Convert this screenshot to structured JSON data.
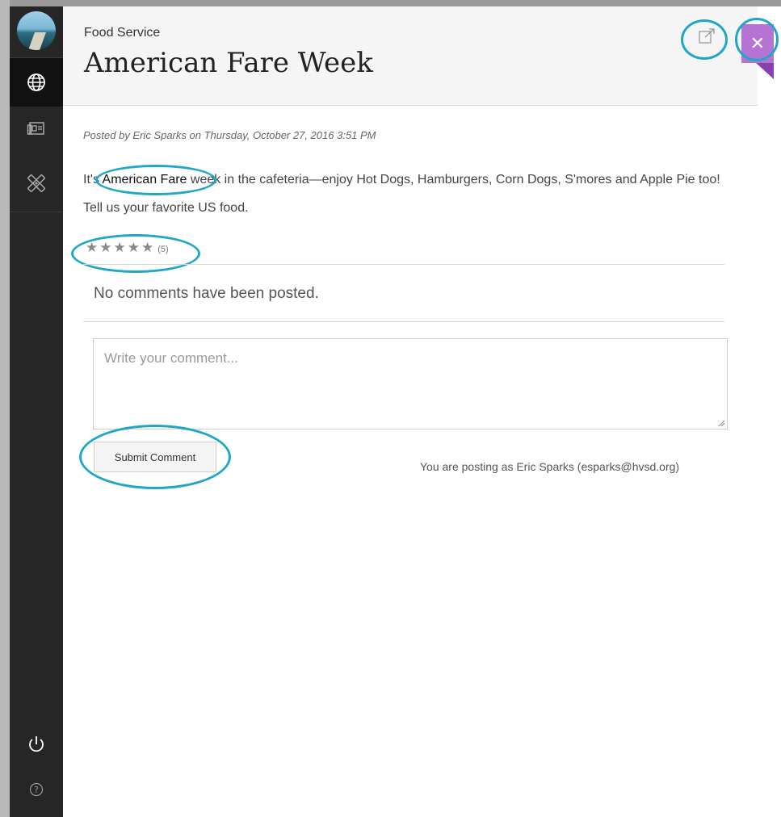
{
  "sidebar": {
    "items": [
      {
        "name": "globe",
        "icon": "globe-icon"
      },
      {
        "name": "news",
        "icon": "newspaper-icon"
      },
      {
        "name": "tools",
        "icon": "tools-icon"
      }
    ],
    "bottom": [
      {
        "name": "power",
        "icon": "power-icon"
      },
      {
        "name": "help",
        "icon": "help-icon"
      }
    ]
  },
  "header": {
    "category": "Food Service",
    "title": "American Fare Week"
  },
  "post": {
    "byline": "Posted by Eric Sparks on Thursday, October 27, 2016 3:51 PM",
    "body_prefix": "It's ",
    "body_highlight": "American Fare",
    "body_suffix": " week in the cafeteria—enjoy Hot Dogs, Hamburgers, Corn Dogs, S'mores and Apple Pie too! Tell us your favorite US food."
  },
  "rating": {
    "stars": "★★★★★",
    "count": "(5)",
    "value": 5,
    "max": 5
  },
  "comments": {
    "empty_message": "No comments have been posted.",
    "placeholder": "Write your comment...",
    "submit_label": "Submit Comment",
    "posting_as": "You are posting as Eric Sparks (esparks@hvsd.org)"
  },
  "colors": {
    "accent": "#21a6c7",
    "close_button": "#b574d3",
    "sidebar": "#262626"
  }
}
